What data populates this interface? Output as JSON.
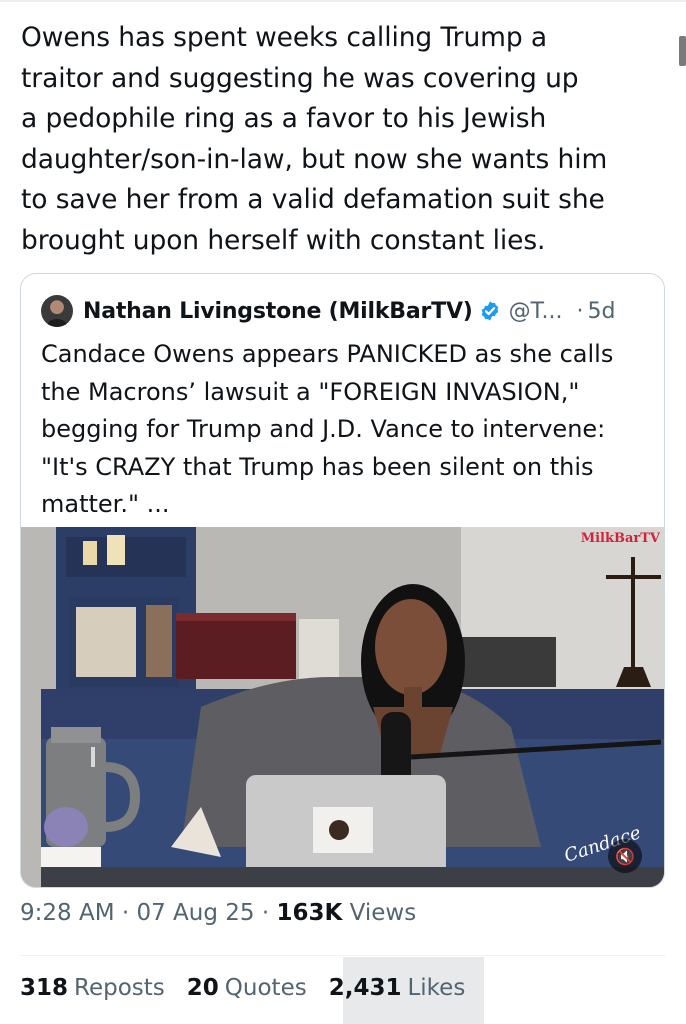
{
  "tweet": {
    "text": "Owens has spent weeks calling Trump a\ntraitor and suggesting he was covering up\na pedophile ring as a favor to his Jewish\ndaughter/son-in-law, but now she wants him\nto save her from a valid defamation suit she\nbrought upon herself with constant lies."
  },
  "quote": {
    "author_name": "Nathan Livingstone (MilkBarTV)",
    "handle": "@T...",
    "separator": "·",
    "age": "5d",
    "text": "Candace Owens appears PANICKED as she calls\nthe Macrons’ lawsuit a \"FOREIGN INVASION,\"\nbegging for Trump and J.D. Vance to intervene:\n\"It's CRAZY that Trump has been silent on this\nmatter.\" ...",
    "media": {
      "watermark": "MilkBarTV",
      "signature": "Candace",
      "mute_icon": "speaker-muted-icon"
    }
  },
  "meta": {
    "time": "9:28 AM",
    "sep1": "·",
    "date": "07 Aug 25",
    "sep2": "·",
    "views_count": "163K",
    "views_label": "Views"
  },
  "stats": {
    "reposts_count": "318",
    "reposts_label": "Reposts",
    "quotes_count": "20",
    "quotes_label": "Quotes",
    "likes_count": "2,431",
    "likes_label": "Likes"
  },
  "colors": {
    "text": "#0f1419",
    "secondary": "#536471",
    "verified": "#1d9bf0",
    "border": "#cfd9de",
    "watermark": "#d6203a"
  }
}
